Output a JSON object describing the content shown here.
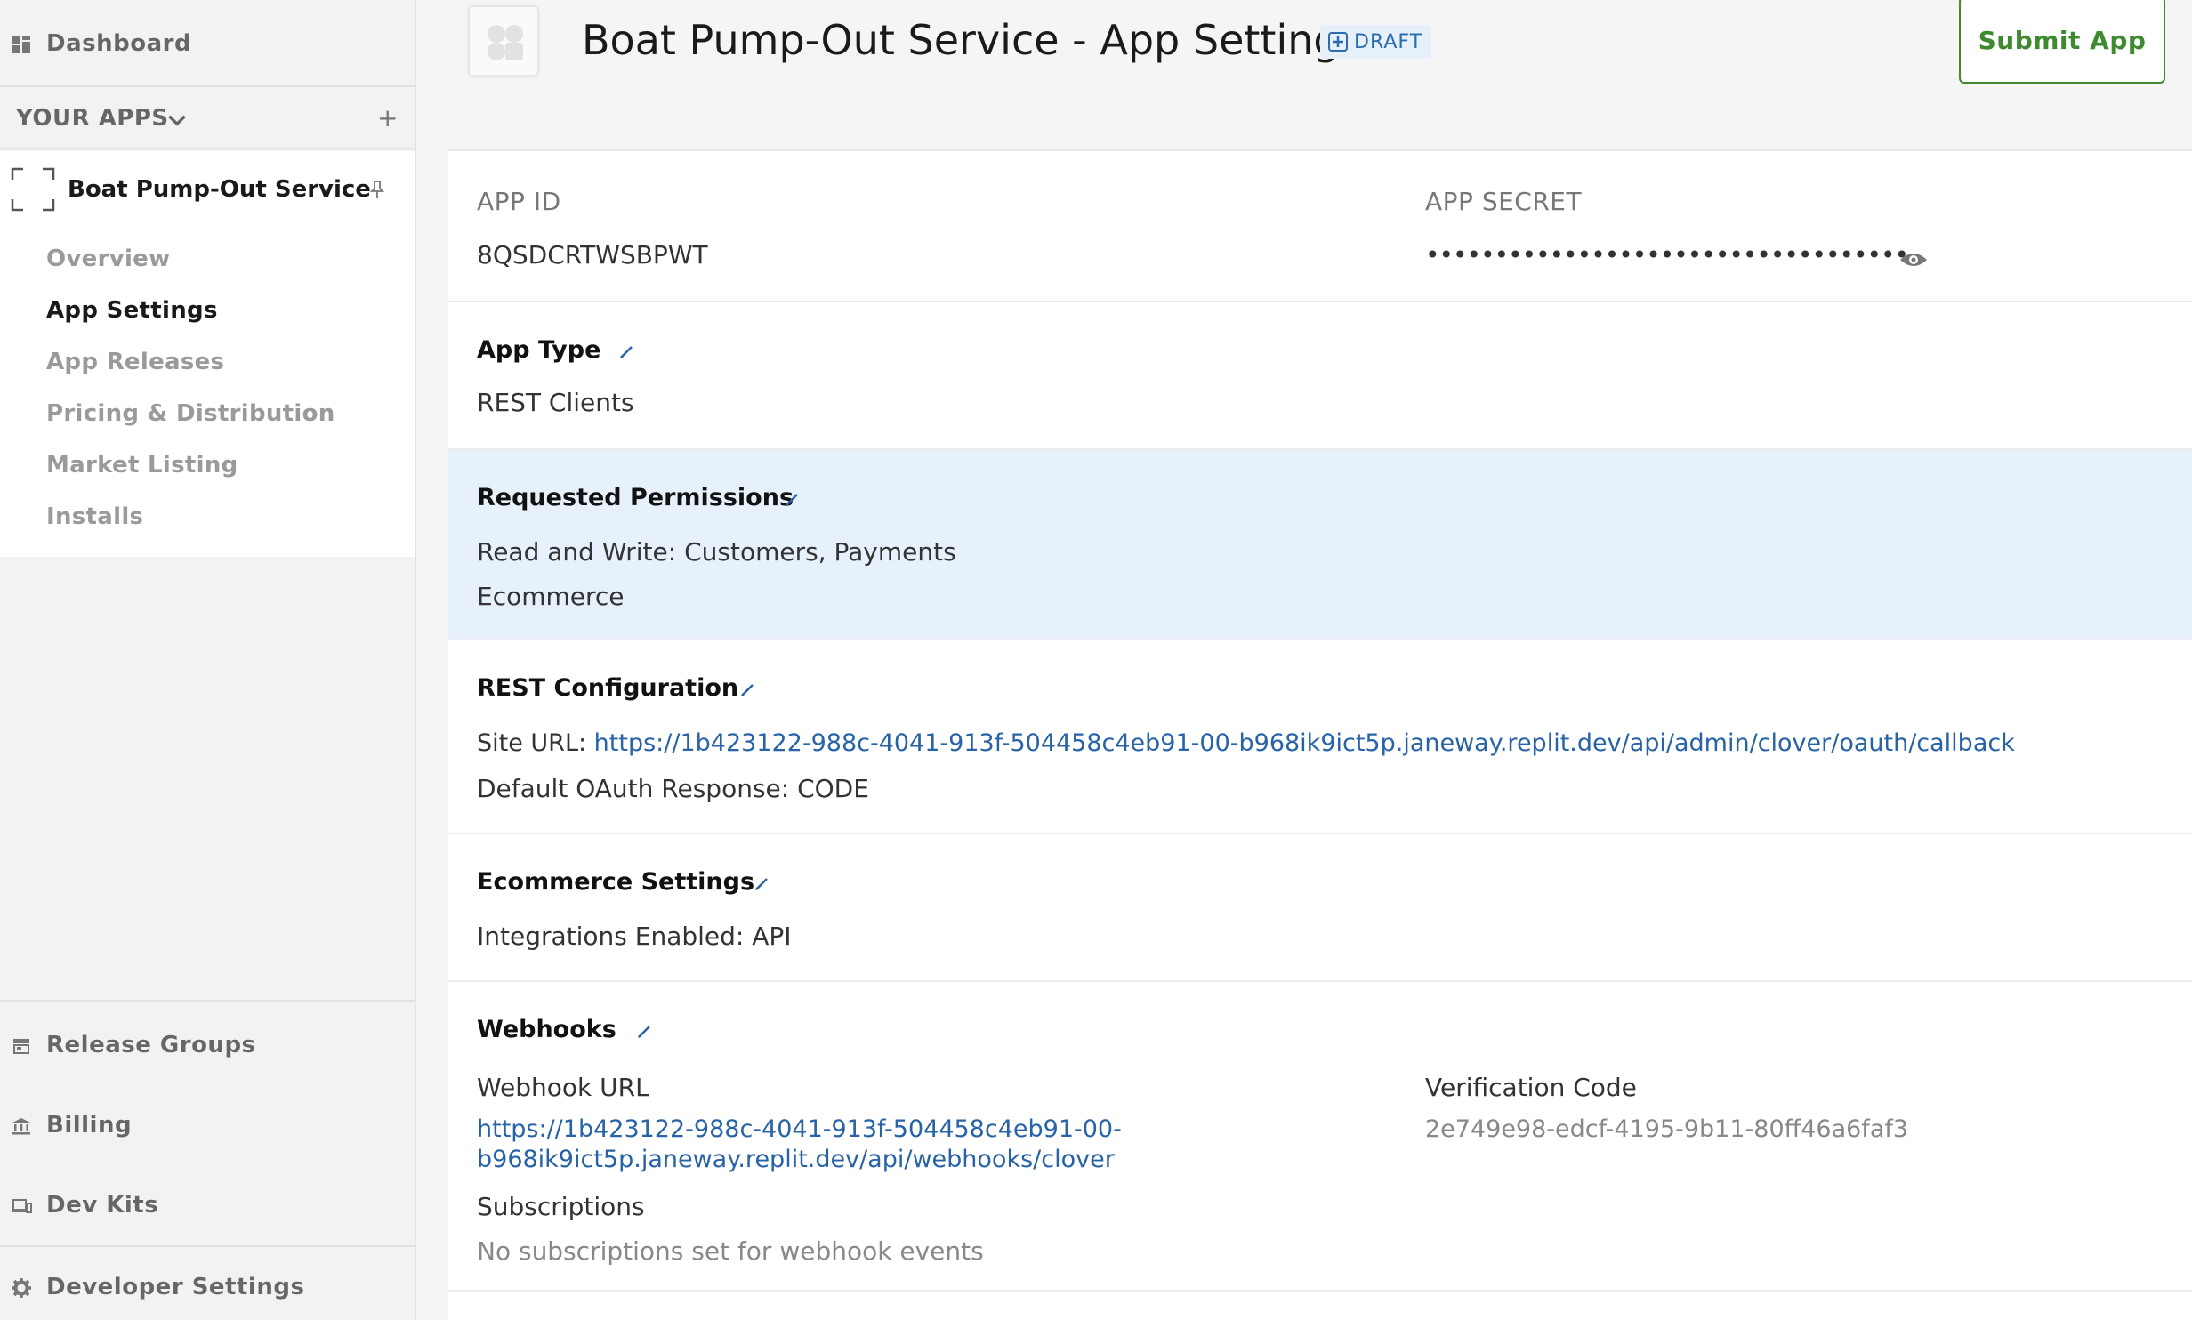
{
  "sidebar": {
    "dashboard_label": "Dashboard",
    "your_apps_label": "YOUR APPS",
    "add_symbol": "+",
    "app_name": "Boat Pump-Out Service",
    "nav": [
      {
        "label": "Overview",
        "active": false
      },
      {
        "label": "App Settings",
        "active": true
      },
      {
        "label": "App Releases",
        "active": false
      },
      {
        "label": "Pricing & Distribution",
        "active": false
      },
      {
        "label": "Market Listing",
        "active": false
      },
      {
        "label": "Installs",
        "active": false
      }
    ],
    "bottom": [
      {
        "label": "Release Groups",
        "icon": "store-icon"
      },
      {
        "label": "Billing",
        "icon": "bank-icon"
      },
      {
        "label": "Dev Kits",
        "icon": "devices-icon"
      },
      {
        "label": "Developer Settings",
        "icon": "gear-icon"
      }
    ]
  },
  "header": {
    "title": "Boat Pump-Out Service - App Settings",
    "badge": "DRAFT",
    "submit_label": "Submit App"
  },
  "credentials": {
    "app_id_label": "APP ID",
    "app_id": "8QSDCRTWSBPWT",
    "app_secret_label": "APP SECRET",
    "app_secret_masked": "•••••••••••••••••••••••••••••••••••"
  },
  "app_type": {
    "title": "App Type",
    "value": "REST Clients"
  },
  "permissions": {
    "title": "Requested Permissions",
    "line1": "Read and Write: Customers, Payments",
    "line2": "Ecommerce"
  },
  "rest_config": {
    "title": "REST Configuration",
    "site_url_label": "Site URL: ",
    "site_url": "https://1b423122-988c-4041-913f-504458c4eb91-00-b968ik9ict5p.janeway.replit.dev/api/admin/clover/oauth/callback",
    "oauth_label": "Default OAuth Response: CODE"
  },
  "ecommerce": {
    "title": "Ecommerce Settings",
    "value": "Integrations Enabled: API"
  },
  "webhooks": {
    "title": "Webhooks",
    "url_label": "Webhook URL",
    "url_line1": "https://1b423122-988c-4041-913f-504458c4eb91-00-",
    "url_line2": "b968ik9ict5p.janeway.replit.dev/api/webhooks/clover",
    "verification_label": "Verification Code",
    "verification_code": "2e749e98-edcf-4195-9b11-80ff46a6faf3",
    "subscriptions_label": "Subscriptions",
    "subscriptions_value": "No subscriptions set for webhook events"
  },
  "colors": {
    "accent_green": "#3f8a2f",
    "link_blue": "#2763a6",
    "highlight_bg": "#e7f1fc"
  }
}
